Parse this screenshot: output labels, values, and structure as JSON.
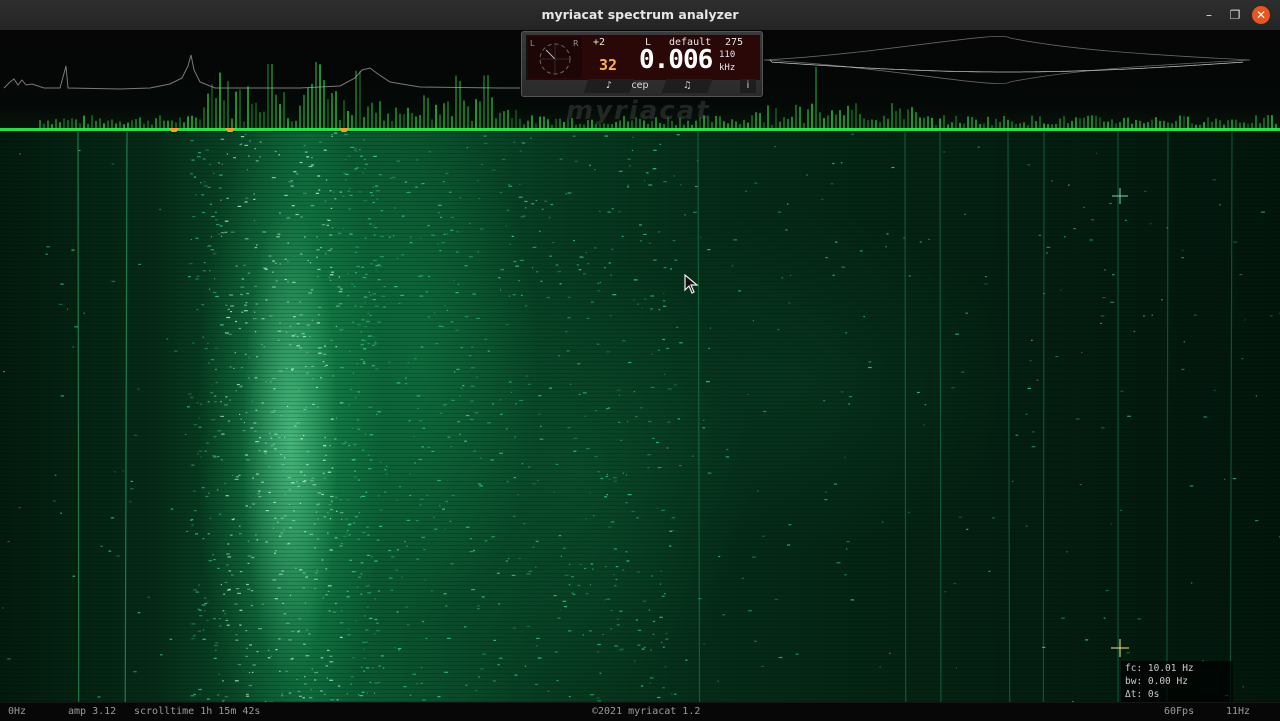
{
  "window": {
    "title": "myriacat spectrum analyzer",
    "controls": {
      "minimize": "–",
      "maximize": "❐",
      "close": "✕"
    }
  },
  "panel": {
    "gain": "+2",
    "channel": "L",
    "preset": "default",
    "bins": "275",
    "mode_value": "32",
    "frequency": "0.006",
    "fft_size": "110",
    "unit": "kHz",
    "meter_left": "L",
    "meter_right": "R",
    "buttons": {
      "note_left": "♪",
      "cep": "cep",
      "note_right": "♫",
      "info": "i"
    }
  },
  "watermark": "myriacat",
  "status": {
    "min_freq": "0Hz",
    "amp": "amp 3.12",
    "scrolltime": "scrolltime 1h 15m 42s",
    "copyright": "©2021 myriacat 1.2",
    "fps": "60Fps",
    "max_freq": "11Hz"
  },
  "readout": {
    "fc": "fc: 10.01 Hz",
    "bw": "bw: 0.00 Hz",
    "dt": "Δt: 0s"
  },
  "colors": {
    "spectrum_green": "#33ff55",
    "marker_orange": "#f0a030",
    "close_button": "#e95420",
    "waterfall_green": "#1fae6a"
  },
  "markers": [
    "marker-1",
    "marker-2",
    "marker-3"
  ]
}
